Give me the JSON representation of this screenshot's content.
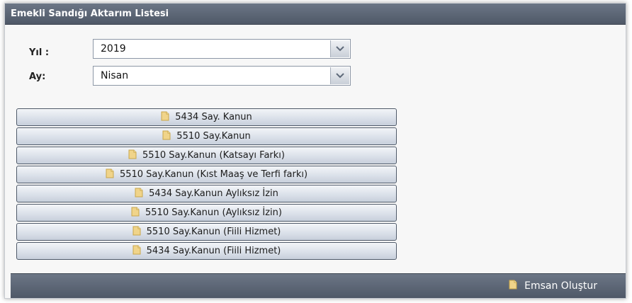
{
  "panel": {
    "title": "Emekli Sandığı Aktarım Listesi"
  },
  "form": {
    "year_label": "Yıl :",
    "year_value": "2019",
    "month_label": "Ay:",
    "month_value": "Nisan"
  },
  "buttons": [
    {
      "label": "5434 Say. Kanun"
    },
    {
      "label": "5510 Say.Kanun"
    },
    {
      "label": "5510 Say.Kanun (Katsayı Farkı)"
    },
    {
      "label": "5510 Say.Kanun (Kıst Maaş ve Terfi farkı)"
    },
    {
      "label": "5434 Say.Kanun Aylıksız İzin"
    },
    {
      "label": "5510 Say.Kanun (Aylıksız İzin)"
    },
    {
      "label": "5510 Say.Kanun (Fiili Hizmet)"
    },
    {
      "label": "5434 Say.Kanun (Fiili Hizmet)"
    }
  ],
  "footer": {
    "action_label": "Emsan Oluştur"
  },
  "icons": {
    "document": "document-icon",
    "dropdown": "chevron-down-icon"
  },
  "colors": {
    "header_bar": "#5d6777",
    "button_border": "#4f5a69",
    "document_icon": "#f0d48a"
  }
}
